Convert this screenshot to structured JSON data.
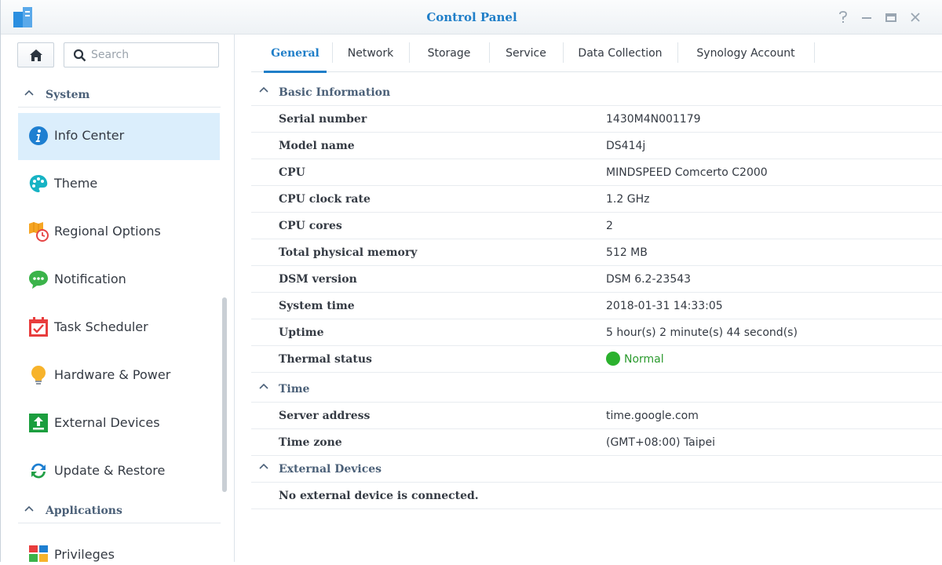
{
  "window": {
    "title": "Control Panel"
  },
  "sidebar": {
    "search_placeholder": "Search",
    "sections": {
      "system": "System",
      "applications": "Applications"
    },
    "items": [
      {
        "label": "Info Center",
        "icon": "info-icon"
      },
      {
        "label": "Theme",
        "icon": "palette-icon"
      },
      {
        "label": "Regional Options",
        "icon": "regional-options-icon"
      },
      {
        "label": "Notification",
        "icon": "chat-bubble-icon"
      },
      {
        "label": "Task Scheduler",
        "icon": "calendar-check-icon"
      },
      {
        "label": "Hardware & Power",
        "icon": "lightbulb-icon"
      },
      {
        "label": "External Devices",
        "icon": "upload-icon"
      },
      {
        "label": "Update & Restore",
        "icon": "refresh-icon"
      },
      {
        "label": "Privileges",
        "icon": "privileges-icon"
      }
    ]
  },
  "tabs": [
    "General",
    "Network",
    "Storage",
    "Service",
    "Data Collection",
    "Synology Account"
  ],
  "content": {
    "basic_info": {
      "title": "Basic Information",
      "rows": [
        {
          "key": "Serial number",
          "value": "1430M4N001179"
        },
        {
          "key": "Model name",
          "value": "DS414j"
        },
        {
          "key": "CPU",
          "value": "MINDSPEED Comcerto C2000"
        },
        {
          "key": "CPU clock rate",
          "value": "1.2 GHz"
        },
        {
          "key": "CPU cores",
          "value": "2"
        },
        {
          "key": "Total physical memory",
          "value": "512 MB"
        },
        {
          "key": "DSM version",
          "value": "DSM 6.2-23543"
        },
        {
          "key": "System time",
          "value": "2018-01-31 14:33:05"
        },
        {
          "key": "Uptime",
          "value": "5 hour(s) 2 minute(s) 44 second(s)"
        },
        {
          "key": "Thermal status",
          "value": "Normal"
        }
      ]
    },
    "time": {
      "title": "Time",
      "rows": [
        {
          "key": "Server address",
          "value": "time.google.com"
        },
        {
          "key": "Time zone",
          "value": "(GMT+08:00) Taipei"
        }
      ]
    },
    "external_devices": {
      "title": "External Devices",
      "message": "No external device is connected."
    }
  },
  "colors": {
    "accent": "#1f7ec8",
    "active_bg": "#dbeefc",
    "status_ok": "#2bb12e"
  }
}
